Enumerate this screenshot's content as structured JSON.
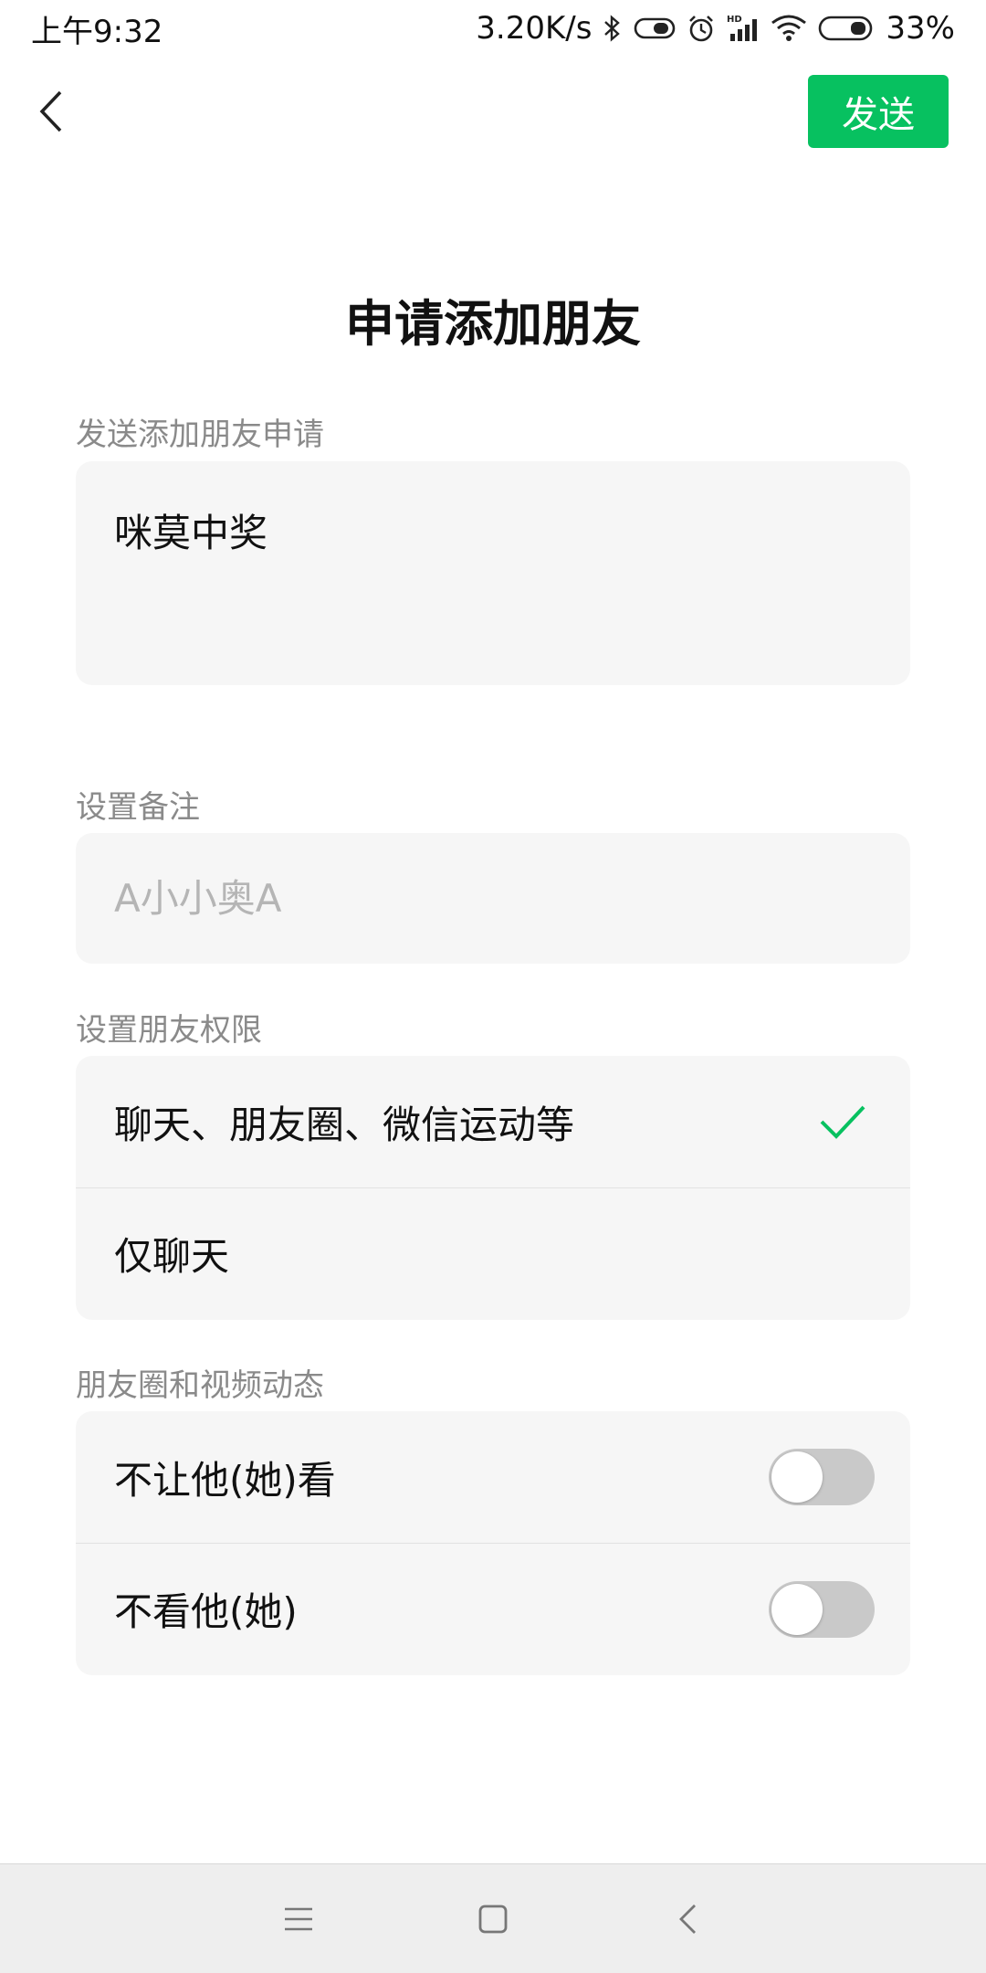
{
  "status_bar": {
    "time": "上午9:32",
    "network_speed": "3.20K/s",
    "battery": "33%",
    "icons": [
      "bluetooth-icon",
      "vpn-key-icon",
      "alarm-icon",
      "hd-signal-icon",
      "wifi-icon",
      "battery-icon"
    ]
  },
  "nav": {
    "back_icon": "chevron-left-icon",
    "send_label": "发送",
    "accent_color": "#07c160"
  },
  "page": {
    "title": "申请添加朋友"
  },
  "request": {
    "label": "发送添加朋友申请",
    "message": "咪莫中奖"
  },
  "remark": {
    "label": "设置备注",
    "placeholder": "A小小奥A"
  },
  "permissions": {
    "label": "设置朋友权限",
    "options": [
      {
        "label": "聊天、朋友圈、微信运动等",
        "selected": true
      },
      {
        "label": "仅聊天",
        "selected": false
      }
    ]
  },
  "moments": {
    "label": "朋友圈和视频动态",
    "toggles": [
      {
        "label": "不让他(她)看",
        "on": false
      },
      {
        "label": "不看他(她)",
        "on": false
      }
    ]
  },
  "bottom_nav": {
    "icons": [
      "menu-icon",
      "home-square-icon",
      "back-triangle-icon"
    ]
  }
}
